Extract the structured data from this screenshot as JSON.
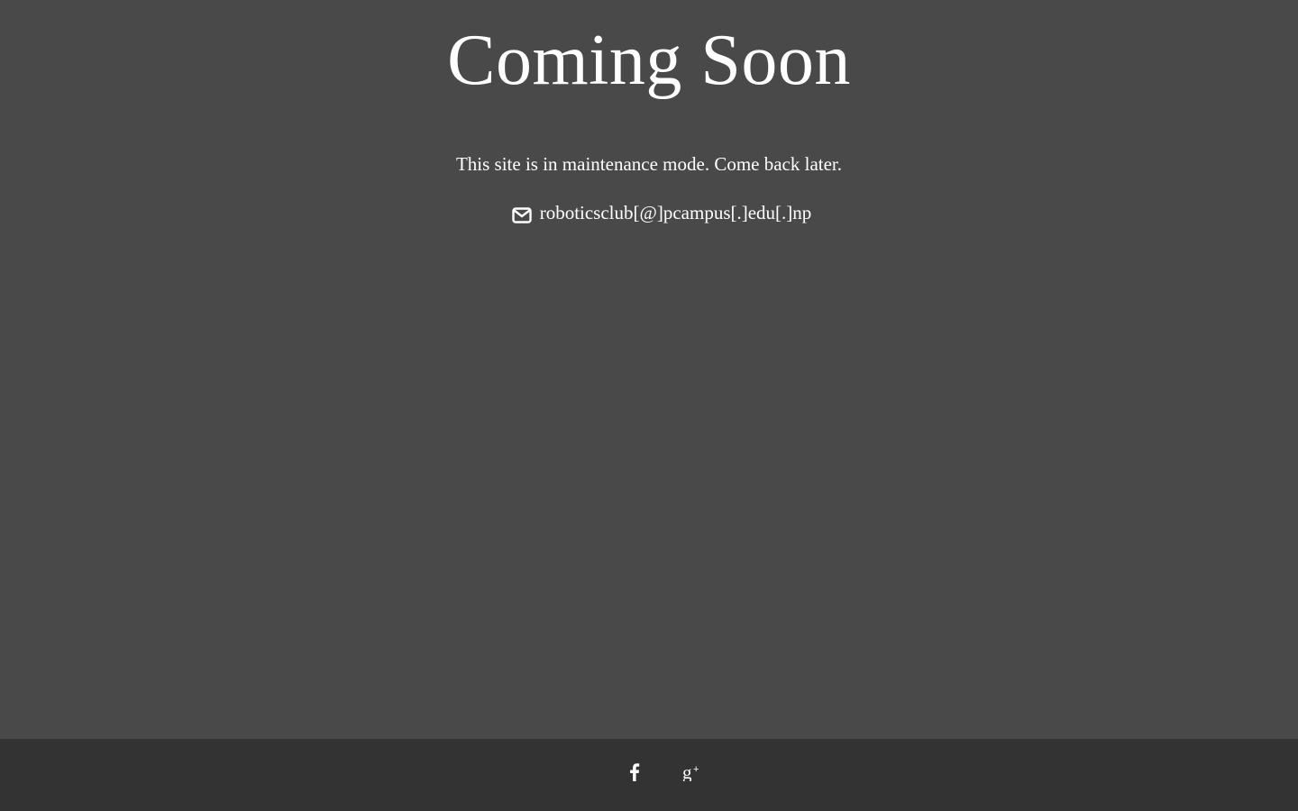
{
  "page": {
    "title": "Coming Soon",
    "message": "This site is in maintenance mode. Come back later.",
    "contact_email": "roboticsclub[@]pcampus[.]edu[.]np"
  },
  "icons": {
    "contact": "envelope-icon",
    "social": [
      "facebook-icon",
      "google-plus-icon"
    ]
  },
  "colors": {
    "background": "#494949",
    "footer": "#333333",
    "text": "#ffffff"
  }
}
